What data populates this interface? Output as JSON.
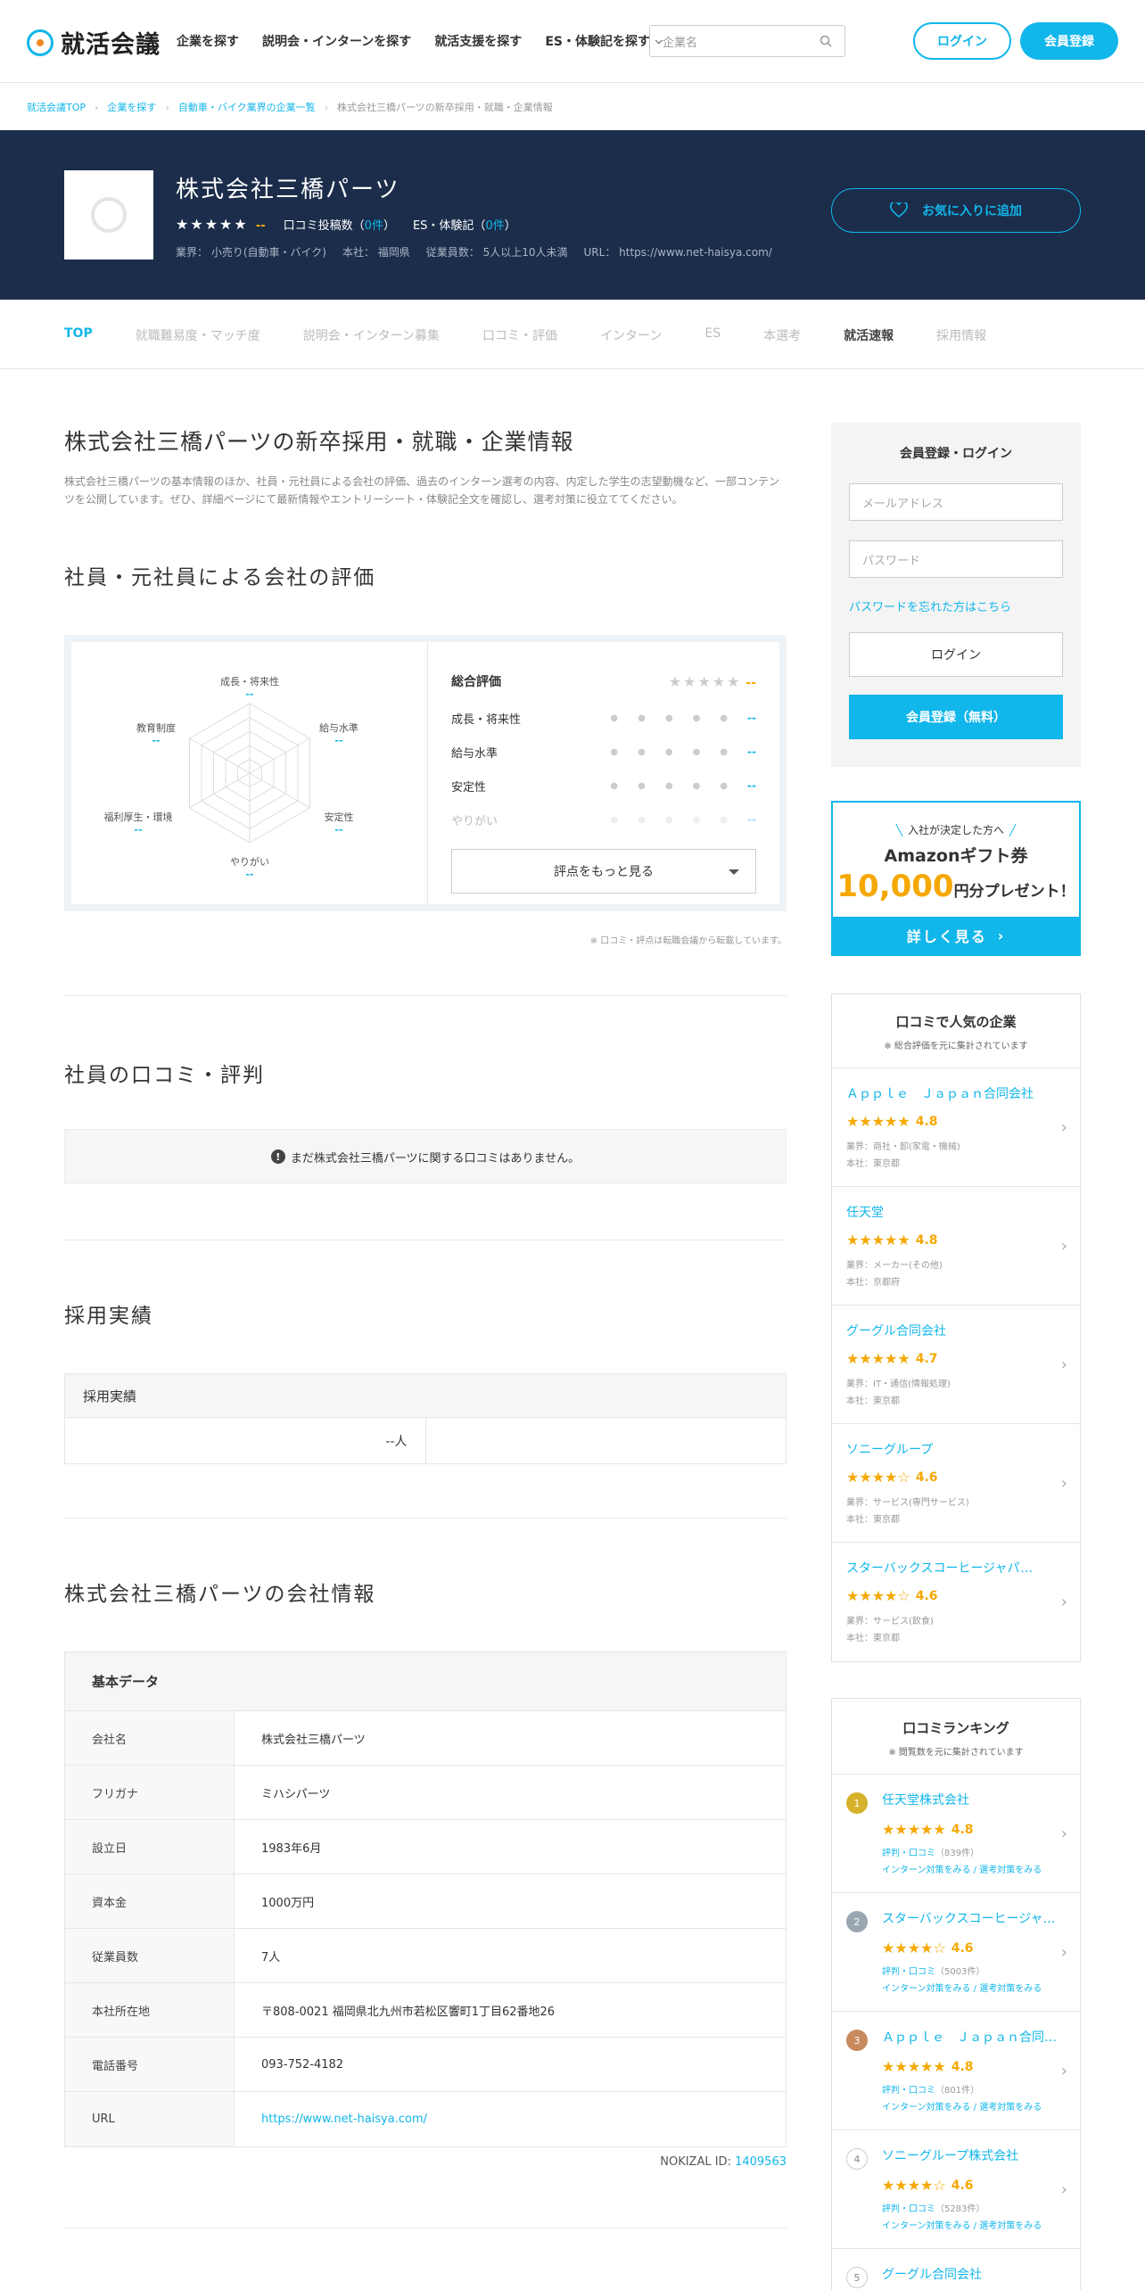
{
  "header": {
    "logo": "就活会議",
    "nav": [
      "企業を探す",
      "説明会・インターンを探す",
      "就活支援を探す",
      "ES・体験記を探す"
    ],
    "search_placeholder": "企業名",
    "login": "ログイン",
    "register": "会員登録"
  },
  "breadcrumb": [
    "就活会議TOP",
    "企業を探す",
    "自動車・バイク業界の企業一覧",
    "株式会社三橋パーツの新卒採用・就職・企業情報"
  ],
  "hero": {
    "name": "株式会社三橋パーツ",
    "rating": "--",
    "reviews_label": "口コミ投稿数（",
    "reviews_count": "0件",
    "reviews_close": "）",
    "es_label": "ES・体験記（",
    "es_count": "0件",
    "es_close": "）",
    "industry": "業界： 小売り(自動車・バイク)",
    "hq": "本社： 福岡県",
    "employees": "従業員数： 5人以上10人未満",
    "url": "URL： https://www.net-haisya.com/",
    "fav": "お気に入りに追加"
  },
  "tabs": [
    "TOP",
    "就職難易度・マッチ度",
    "説明会・インターン募集",
    "口コミ・評価",
    "インターン",
    "ES",
    "本選考",
    "就活速報",
    "採用情報"
  ],
  "main": {
    "title": "株式会社三橋パーツの新卒採用・就職・企業情報",
    "desc": "株式会社三橋パーツの基本情報のほか、社員・元社員による会社の評価、過去のインターン選考の内容、内定した学生の志望動機など、一部コンテンツを公開しています。ぜひ、詳細ページにて最新情報やエントリーシート・体験記全文を確認し、選考対策に役立ててください。",
    "eval_title": "社員・元社員による会社の評価",
    "radar": [
      {
        "label": "成長・将来性",
        "value": "--"
      },
      {
        "label": "給与水準",
        "value": "--"
      },
      {
        "label": "安定性",
        "value": "--"
      },
      {
        "label": "やりがい",
        "value": "--"
      },
      {
        "label": "福利厚生・環境",
        "value": "--"
      },
      {
        "label": "教育制度",
        "value": "--"
      }
    ],
    "total_label": "総合評価",
    "total_value": "--",
    "scores": [
      {
        "label": "成長・将来性",
        "value": "--"
      },
      {
        "label": "給与水準",
        "value": "--"
      },
      {
        "label": "安定性",
        "value": "--"
      },
      {
        "label": "やりがい",
        "value": "--"
      }
    ],
    "more": "評点をもっと見る",
    "note": "※ 口コミ・評点は転職会議から転載しています。",
    "review_title": "社員の口コミ・評判",
    "no_review": "まだ株式会社三橋パーツに関する口コミはありません。",
    "recruit_title": "採用実績",
    "recruit_head": "採用実績",
    "recruit_value": "--人",
    "info_title": "株式会社三橋パーツの会社情報",
    "basic": "基本データ",
    "rows": [
      {
        "k": "会社名",
        "v": "株式会社三橋パーツ"
      },
      {
        "k": "フリガナ",
        "v": "ミハシパーツ"
      },
      {
        "k": "設立日",
        "v": "1983年6月"
      },
      {
        "k": "資本金",
        "v": "1000万円"
      },
      {
        "k": "従業員数",
        "v": "7人"
      },
      {
        "k": "本社所在地",
        "v": "〒808-0021 福岡県北九州市若松区響町1丁目62番地26"
      },
      {
        "k": "電話番号",
        "v": "093-752-4182"
      },
      {
        "k": "URL",
        "v": "https://www.net-haisya.com/"
      }
    ],
    "nokizal_label": "NOKIZAL ID: ",
    "nokizal_id": "1409563"
  },
  "sidebar": {
    "login_title": "会員登録・ログイン",
    "email_ph": "メールアドレス",
    "pw_ph": "パスワード",
    "forgot": "パスワードを忘れた方はこちら",
    "login": "ログイン",
    "register": "会員登録（無料）",
    "amazon_l1": "入社が決定した方へ",
    "amazon_l2": "Amazonギフト券",
    "amazon_amount": "10,000",
    "amazon_suffix": "円分プレゼント！",
    "amazon_cta": "詳しく見る",
    "popular_title": "口コミで人気の企業",
    "popular_sub": "※ 総合評価を元に集計されています",
    "popular": [
      {
        "name": "Ａｐｐｌｅ　Ｊａｐａｎ合同会社",
        "rating": "4.8",
        "industry": "業界：商社・卸(家電・機械)",
        "hq": "本社：東京都"
      },
      {
        "name": "任天堂",
        "rating": "4.8",
        "industry": "業界：メーカー(その他)",
        "hq": "本社：京都府"
      },
      {
        "name": "グーグル合同会社",
        "rating": "4.7",
        "industry": "業界：IT・通信(情報処理)",
        "hq": "本社：東京都"
      },
      {
        "name": "ソニーグループ",
        "rating": "4.6",
        "industry": "業界：サービス(専門サービス)",
        "hq": "本社：東京都"
      },
      {
        "name": "スターバックスコーヒージャパン株式会社",
        "rating": "4.6",
        "industry": "業界：サービス(飲食)",
        "hq": "本社：東京都"
      }
    ],
    "ranking_title": "口コミランキング",
    "ranking_sub": "※ 閲覧数を元に集計されています",
    "ranking": [
      {
        "rank": "1",
        "name": "任天堂株式会社",
        "rating": "4.8",
        "reviews": "評判・口コミ",
        "count": "（839件）",
        "links": "インターン対策をみる / 選考対策をみる",
        "color": "#d6b22a"
      },
      {
        "rank": "2",
        "name": "スターバックスコーヒージャパン株式会社",
        "rating": "4.6",
        "reviews": "評判・口コミ",
        "count": "（5003件）",
        "links": "インターン対策をみる / 選考対策をみる",
        "color": "#9aa6b2"
      },
      {
        "rank": "3",
        "name": "Ａｐｐｌｅ　Ｊａｐａｎ合同会社",
        "rating": "4.8",
        "reviews": "評判・口コミ",
        "count": "（801件）",
        "links": "インターン対策をみる / 選考対策をみる",
        "color": "#c98a5e"
      },
      {
        "rank": "4",
        "name": "ソニーグループ株式会社",
        "rating": "4.6",
        "reviews": "評判・口コミ",
        "count": "（5283件）",
        "links": "インターン対策をみる / 選考対策をみる",
        "color": "#ffffff"
      },
      {
        "rank": "5",
        "name": "グーグル合同会社",
        "rating": "",
        "reviews": "",
        "count": "",
        "links": "",
        "color": "#ffffff"
      }
    ]
  }
}
